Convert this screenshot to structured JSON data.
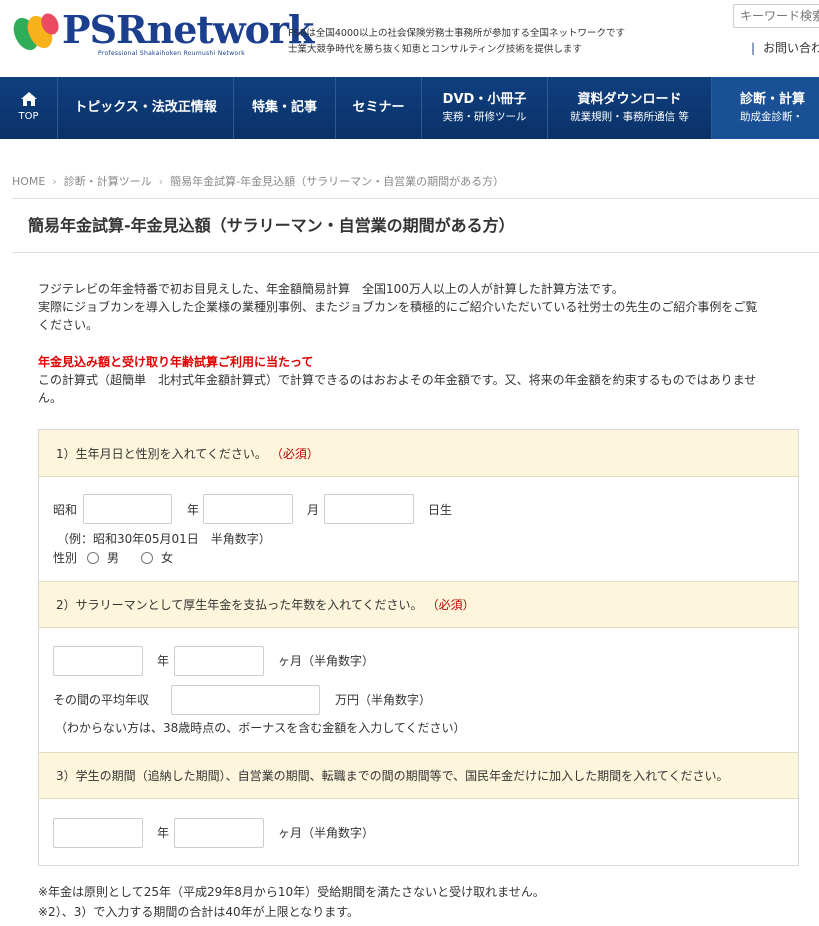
{
  "header": {
    "logo_text": "PSRnetwork",
    "logo_sub": "Professional Shakaihoken Roumushi Network",
    "tagline1": "PSRは全国4000以上の社会保険労務士事務所が参加する全国ネットワークです",
    "tagline2": "士業大競争時代を勝ち抜く知恵とコンサルティング技術を提供します",
    "search_placeholder": "キーワード検索",
    "contact": "お問い合わ"
  },
  "nav": {
    "home": "TOP",
    "items": [
      {
        "main": "トピックス・法改正情報",
        "sub": ""
      },
      {
        "main": "特集・記事",
        "sub": ""
      },
      {
        "main": "セミナー",
        "sub": ""
      },
      {
        "main": "DVD・小冊子",
        "sub": "実務・研修ツール"
      },
      {
        "main": "資料ダウンロード",
        "sub": "就業規則・事務所通信 等"
      },
      {
        "main": "診断・計算",
        "sub": "助成金診断・"
      }
    ]
  },
  "breadcrumb": [
    "HOME",
    "診断・計算ツール",
    "簡易年金試算-年金見込額（サラリーマン・自営業の期間がある方）"
  ],
  "page_title": "簡易年金試算-年金見込額（サラリーマン・自営業の期間がある方）",
  "intro": {
    "line1": "フジテレビの年金特番で初お目見えした、年金額簡易計算　全国100万人以上の人が計算した計算方法です。",
    "line2": "実際にジョブカンを導入した企業様の業種別事例、またジョブカンを積極的にご紹介いただいている社労士の先生のご紹介事例をご覧",
    "line3": "ください。",
    "notice_heading": "年金見込み額と受け取り年齢試算ご利用に当たって",
    "notice_line1": "この計算式（超簡単　北村式年金額計算式）で計算できるのはおおよその年金額です。又、将来の年金額を約束するものではありませ",
    "notice_line2": "ん。"
  },
  "form": {
    "required": "（必須）",
    "s1": {
      "heading": "1）生年月日と性別を入れてください。",
      "era": "昭和",
      "year": "年",
      "month": "月",
      "day": "日生",
      "example": "（例：昭和30年05月01日　半角数字）",
      "gender_label": "性別",
      "male": "男",
      "female": "女"
    },
    "s2": {
      "heading": "2）サラリーマンとして厚生年金を支払った年数を入れてください。",
      "year": "年",
      "month": "ヶ月（半角数字）",
      "income_label": "その間の平均年収",
      "income_unit": "万円（半角数字）",
      "hint": "（わからない方は、38歳時点の、ボーナスを含む金額を入力してください）"
    },
    "s3": {
      "heading": "3）学生の期間（追納した期間）、自営業の期間、転職までの間の期間等で、国民年金だけに加入した期間を入れてください。",
      "year": "年",
      "month": "ヶ月（半角数字）"
    }
  },
  "notes": {
    "n1": "※年金は原則として25年（平成29年8月から10年）受給期間を満たさないと受け取れません。",
    "n2": "※2）、3）で入力する期間の合計は40年が上限となります。"
  },
  "colors": {
    "nav_bg": "#0f3f80",
    "section_head_bg": "#fdf6dc",
    "required": "#c00000",
    "notice": "#e00000"
  }
}
